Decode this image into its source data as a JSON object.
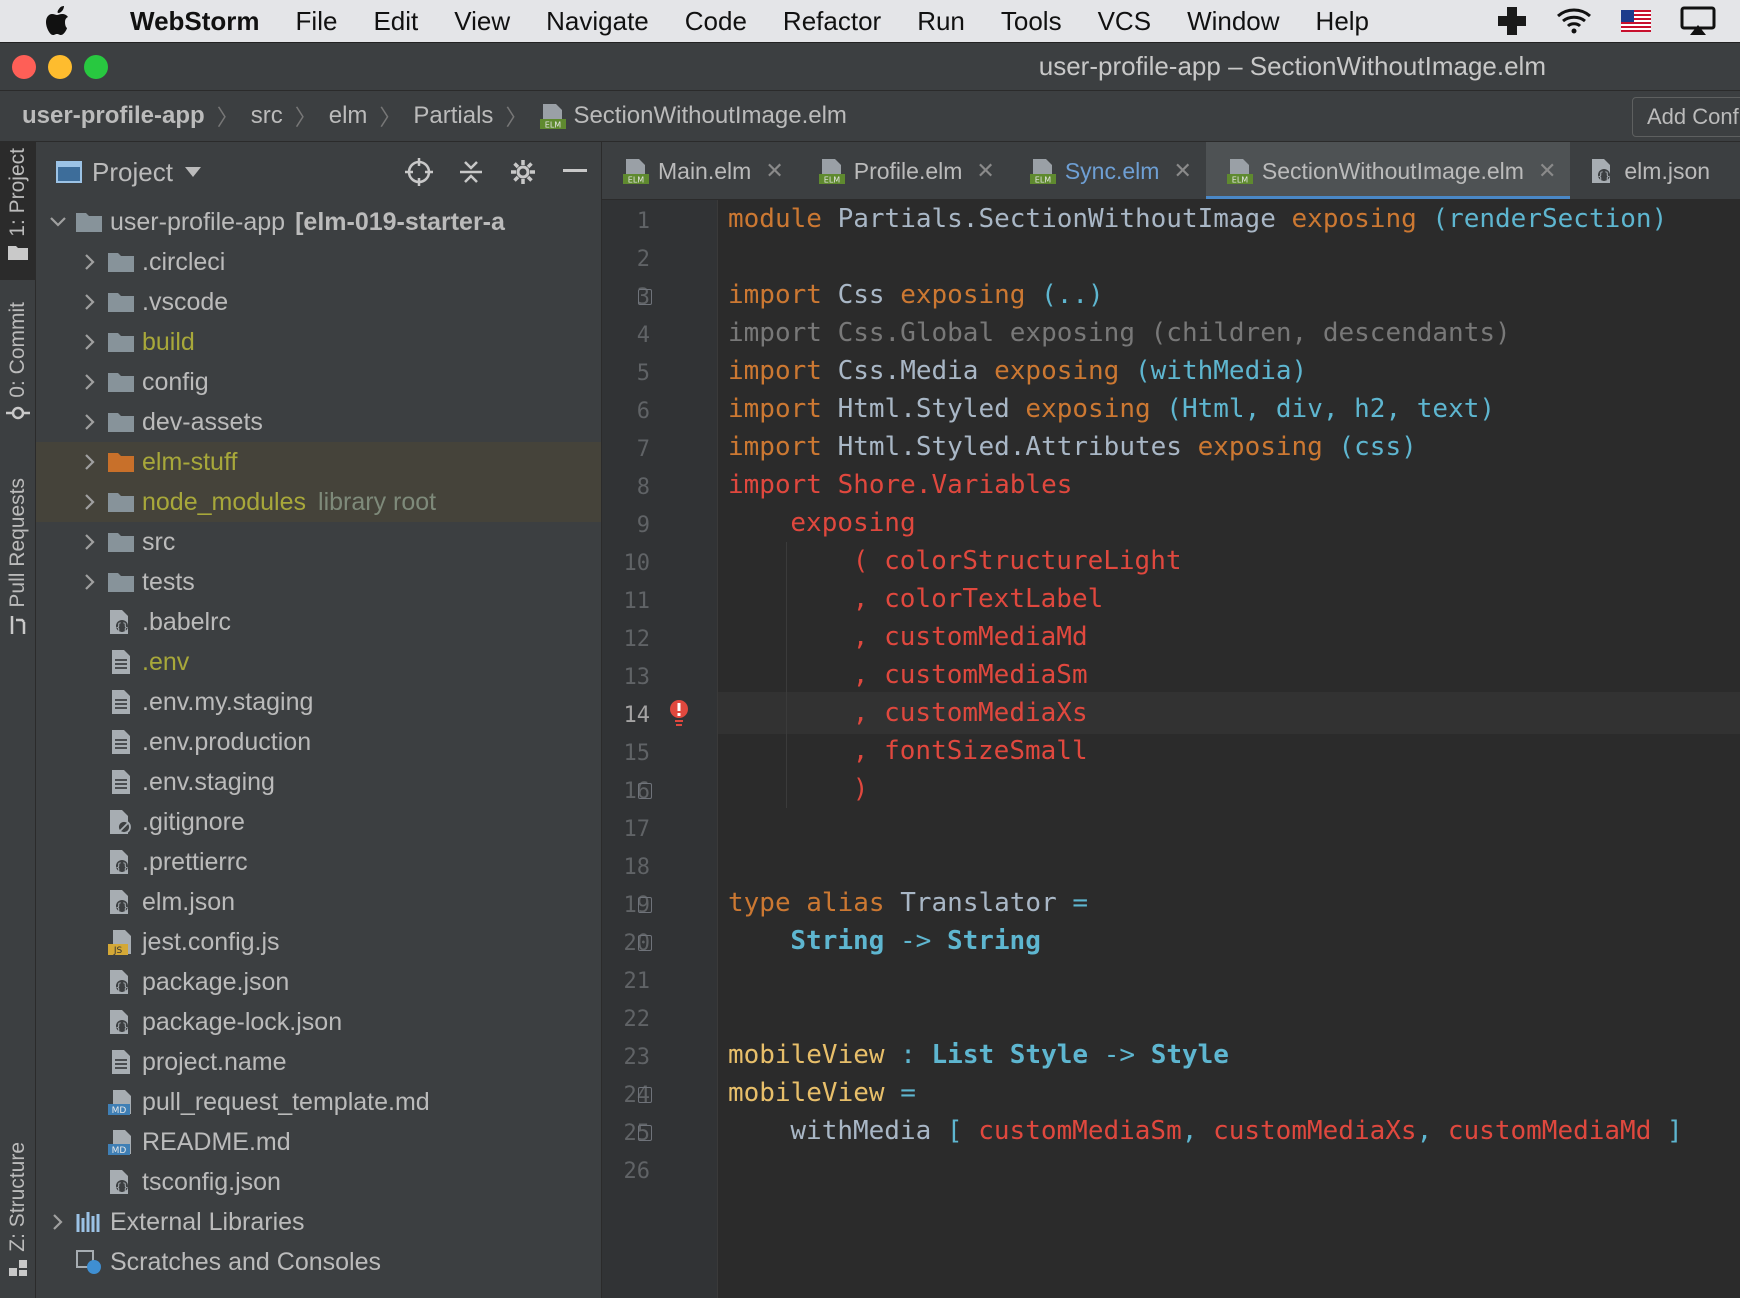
{
  "menubar": {
    "app": "WebStorm",
    "items": [
      "File",
      "Edit",
      "View",
      "Navigate",
      "Code",
      "Refactor",
      "Run",
      "Tools",
      "VCS",
      "Window",
      "Help"
    ]
  },
  "window": {
    "title": "user-profile-app – SectionWithoutImage.elm"
  },
  "breadcrumb": {
    "items": [
      "user-profile-app",
      "src",
      "elm",
      "Partials",
      "SectionWithoutImage.elm"
    ],
    "add_configuration": "Add Configuration..."
  },
  "toolstrip": {
    "project": "1: Project",
    "commit": "0: Commit",
    "pull_requests": "Pull Requests",
    "structure": "Z: Structure"
  },
  "project_panel": {
    "title": "Project",
    "root_name": "user-profile-app",
    "root_branch": "[elm-019-starter-a",
    "items": [
      {
        "label": ".circleci",
        "kind": "folder"
      },
      {
        "label": ".vscode",
        "kind": "folder"
      },
      {
        "label": "build",
        "kind": "folder"
      },
      {
        "label": "config",
        "kind": "folder"
      },
      {
        "label": "dev-assets",
        "kind": "folder"
      },
      {
        "label": "elm-stuff",
        "kind": "folder"
      },
      {
        "label": "node_modules",
        "kind": "folder",
        "extra": "library root"
      },
      {
        "label": "src",
        "kind": "folder"
      },
      {
        "label": "tests",
        "kind": "folder"
      },
      {
        "label": ".babelrc",
        "kind": "config"
      },
      {
        "label": ".env",
        "kind": "text"
      },
      {
        "label": ".env.my.staging",
        "kind": "text"
      },
      {
        "label": ".env.production",
        "kind": "text"
      },
      {
        "label": ".env.staging",
        "kind": "text"
      },
      {
        "label": ".gitignore",
        "kind": "ignore"
      },
      {
        "label": ".prettierrc",
        "kind": "config"
      },
      {
        "label": "elm.json",
        "kind": "config"
      },
      {
        "label": "jest.config.js",
        "kind": "js"
      },
      {
        "label": "package.json",
        "kind": "config"
      },
      {
        "label": "package-lock.json",
        "kind": "config"
      },
      {
        "label": "project.name",
        "kind": "text"
      },
      {
        "label": "pull_request_template.md",
        "kind": "md"
      },
      {
        "label": "README.md",
        "kind": "md"
      },
      {
        "label": "tsconfig.json",
        "kind": "config"
      }
    ],
    "external_libraries": "External Libraries",
    "scratches": "Scratches and Consoles"
  },
  "tabs": [
    {
      "label": "Main.elm",
      "active": false
    },
    {
      "label": "Profile.elm",
      "active": false
    },
    {
      "label": "Sync.elm",
      "active": false
    },
    {
      "label": "SectionWithoutImage.elm",
      "active": true
    },
    {
      "label": "elm.json",
      "active": false
    }
  ],
  "editor": {
    "current_line": 14,
    "line_numbers": [
      "1",
      "2",
      "3",
      "4",
      "5",
      "6",
      "7",
      "8",
      "9",
      "10",
      "11",
      "12",
      "13",
      "14",
      "15",
      "16",
      "17",
      "18",
      "19",
      "20",
      "21",
      "22",
      "23",
      "24",
      "25",
      "26"
    ],
    "lines": {
      "l1": {
        "a": "module",
        "b": " Partials.SectionWithoutImage ",
        "c": "exposing",
        "d": " (renderSection)"
      },
      "l3": {
        "a": "import",
        "b": " Css ",
        "c": "exposing",
        "d": " (..)"
      },
      "l4": "import Css.Global exposing (children, descendants)",
      "l5": {
        "a": "import",
        "b": " Css.Media ",
        "c": "exposing",
        "d": " (withMedia)"
      },
      "l6": {
        "a": "import",
        "b": " Html.Styled ",
        "c": "exposing",
        "d": " (Html, div, h2, text)"
      },
      "l7": {
        "a": "import",
        "b": " Html.Styled.Attributes ",
        "c": "exposing",
        "d": " (css)"
      },
      "l8": "import Shore.Variables",
      "l9": "exposing",
      "l10": "( colorStructureLight",
      "l11": ", colorTextLabel",
      "l12": ", customMediaMd",
      "l13": ", customMediaSm",
      "l14": ", customMediaXs",
      "l15": ", fontSizeSmall",
      "l16": ")",
      "l19": {
        "a": "type",
        "b": " alias",
        "c": " Translator",
        "d": " ="
      },
      "l20": {
        "a": "String",
        "b": " -> ",
        "c": "String"
      },
      "l23": {
        "a": "mobileView",
        "b": " : ",
        "c": "List Style",
        "d": " -> ",
        "e": "Style"
      },
      "l24": {
        "a": "mobileView",
        "b": " ="
      },
      "l25": {
        "a": "withMedia",
        "b": " [ ",
        "c": "customMediaSm",
        "d": ", ",
        "e": "customMediaXs",
        "f": ", ",
        "g": "customMediaMd",
        "h": " ]"
      }
    }
  },
  "colors": {
    "keyword": "#cc7832",
    "error": "#e0483e",
    "type": "#5eb6d0",
    "function": "#e8bf6a",
    "accent": "#4a88c7"
  }
}
